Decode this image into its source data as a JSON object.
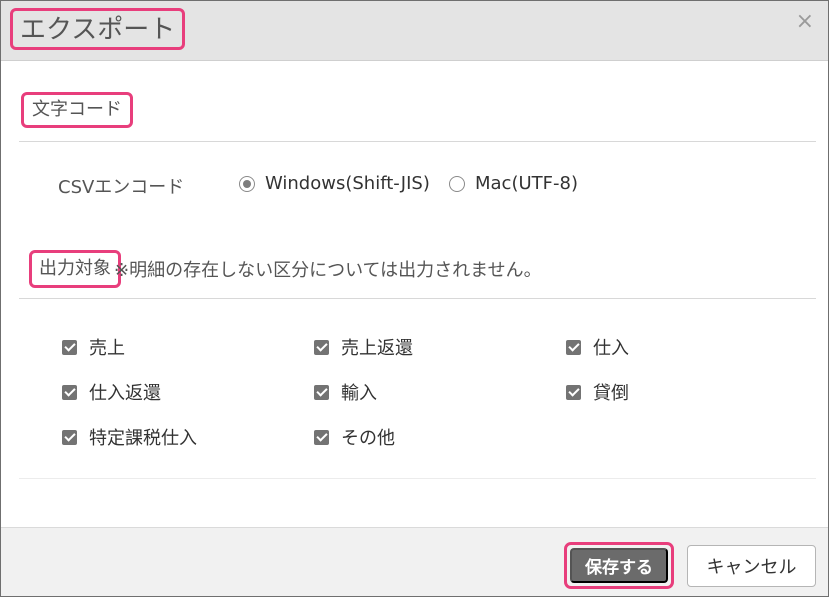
{
  "dialog": {
    "title": "エクスポート",
    "close_symbol": "×",
    "close_icon": "close-icon"
  },
  "encoding": {
    "section_label": "文字コード",
    "field_label": "CSVエンコード",
    "options": [
      {
        "label": "Windows(Shift-JIS)",
        "selected": true
      },
      {
        "label": "Mac(UTF-8)",
        "selected": false
      }
    ]
  },
  "targets": {
    "section_label": "出力対象",
    "note": "※明細の存在しない区分については出力されません。",
    "items": [
      {
        "label": "売上",
        "checked": true
      },
      {
        "label": "売上返還",
        "checked": true
      },
      {
        "label": "仕入",
        "checked": true
      },
      {
        "label": "仕入返還",
        "checked": true
      },
      {
        "label": "輸入",
        "checked": true
      },
      {
        "label": "貸倒",
        "checked": true
      },
      {
        "label": "特定課税仕入",
        "checked": true
      },
      {
        "label": "その他",
        "checked": true
      }
    ]
  },
  "footer": {
    "save_label": "保存する",
    "cancel_label": "キャンセル"
  },
  "colors": {
    "highlight": "#e83e7c",
    "header_bg": "#e4e4e4",
    "save_button_bg": "#6b6b6b"
  }
}
